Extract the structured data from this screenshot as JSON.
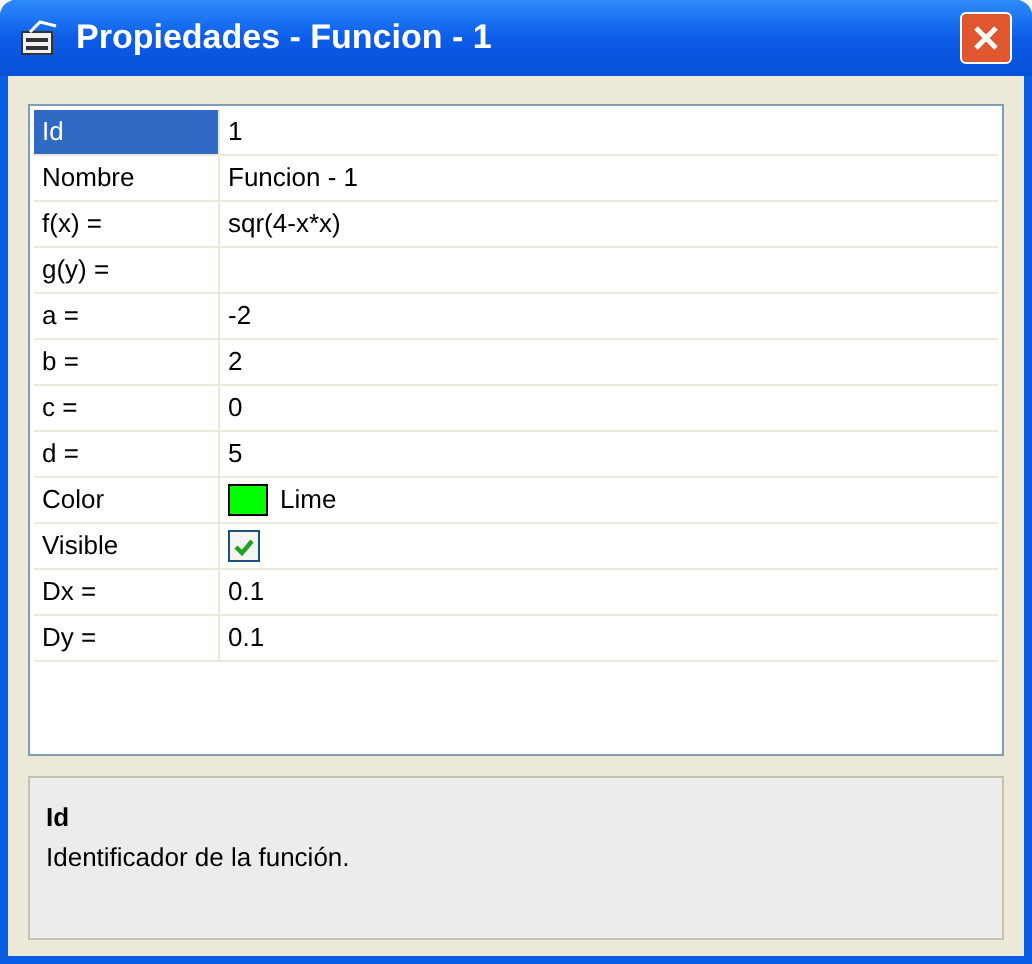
{
  "window": {
    "title": "Propiedades - Funcion - 1"
  },
  "properties": [
    {
      "kind": "text",
      "name": "Id",
      "value": "1",
      "selected": true
    },
    {
      "kind": "text",
      "name": "Nombre",
      "value": "Funcion - 1",
      "selected": false
    },
    {
      "kind": "text",
      "name": "f(x) =",
      "value": "sqr(4-x*x)",
      "selected": false
    },
    {
      "kind": "text",
      "name": "g(y) =",
      "selected": false
    },
    {
      "kind": "text",
      "name": "a =",
      "value": "-2",
      "selected": false
    },
    {
      "kind": "text",
      "name": "b =",
      "value": "2",
      "selected": false
    },
    {
      "kind": "text",
      "name": "c =",
      "value": "0",
      "selected": false
    },
    {
      "kind": "text",
      "name": "d =",
      "value": "5",
      "selected": false
    },
    {
      "kind": "color",
      "name": "Color",
      "value": "Lime",
      "color": "#00ff00",
      "selected": false
    },
    {
      "kind": "checkbox",
      "name": "Visible",
      "checked": true,
      "selected": false
    },
    {
      "kind": "text",
      "name": "Dx =",
      "value": "0.1",
      "selected": false
    },
    {
      "kind": "text",
      "name": "Dy =",
      "value": "0.1",
      "selected": false
    }
  ],
  "description": {
    "title": "Id",
    "text": "Identificador de la función."
  }
}
